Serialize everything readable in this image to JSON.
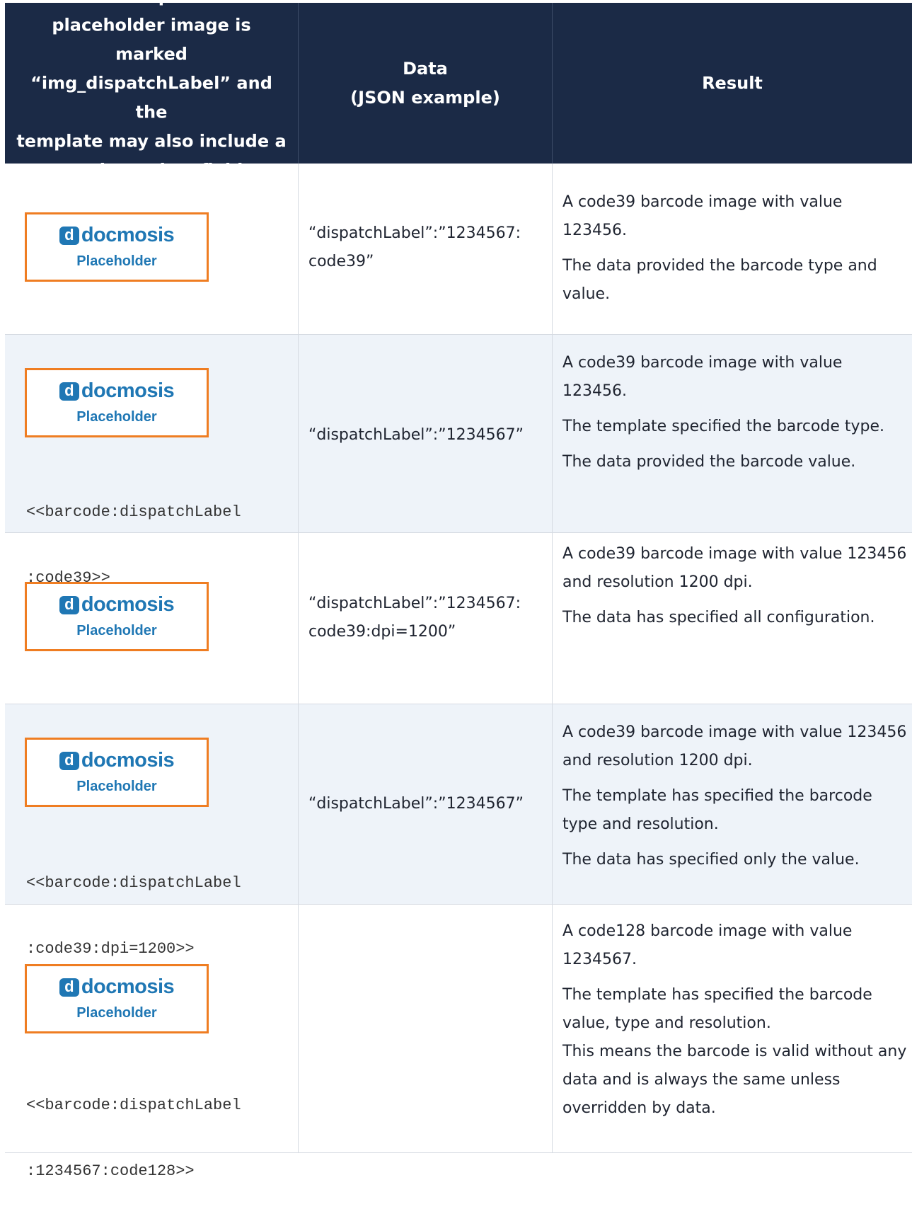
{
  "header": {
    "col1_lines": [
      "In the Template the",
      "placeholder image is marked",
      "“img_dispatchLabel” and the",
      "template may also include a",
      "“<<barcode:” field"
    ],
    "col2_lines": [
      "Data",
      "(JSON example)"
    ],
    "col3": "Result"
  },
  "placeholder": {
    "badge": "d",
    "brand": "docmosis",
    "label": "Placeholder"
  },
  "rows": [
    {
      "field_lines": [],
      "data_lines": [
        "“dispatchLabel”:”1234567:",
        "code39”"
      ],
      "result": [
        "A code39 barcode image with value 123456.",
        "The data provided the barcode type and value."
      ]
    },
    {
      "field_lines": [
        "<<barcode:dispatchLabel",
        ":code39>>"
      ],
      "data_lines": [
        "“dispatchLabel”:”1234567”"
      ],
      "result": [
        "A code39 barcode image with value 123456.",
        "The template specified the barcode type.",
        "The data provided the barcode value."
      ]
    },
    {
      "field_lines": [],
      "data_lines": [
        "“dispatchLabel”:”1234567:",
        "code39:dpi=1200”"
      ],
      "result": [
        "A code39 barcode image with value 123456 and resolution 1200 dpi.",
        "The data has specified all configuration."
      ]
    },
    {
      "field_lines": [
        "<<barcode:dispatchLabel",
        ":code39:dpi=1200>>"
      ],
      "data_lines": [
        "“dispatchLabel”:”1234567”"
      ],
      "result": [
        "A code39 barcode image with value 123456 and resolution 1200 dpi.",
        "The template has specified the barcode type and resolution.",
        "The data has specified only the value."
      ]
    },
    {
      "field_lines": [
        "<<barcode:dispatchLabel",
        ":1234567:code128>>"
      ],
      "data_lines": [],
      "result": [
        "A code128 barcode image with value 1234567.",
        "The template has specified the barcode value, type and resolution.",
        "This means the barcode is valid without any data and is always the same unless overridden by data."
      ]
    }
  ]
}
